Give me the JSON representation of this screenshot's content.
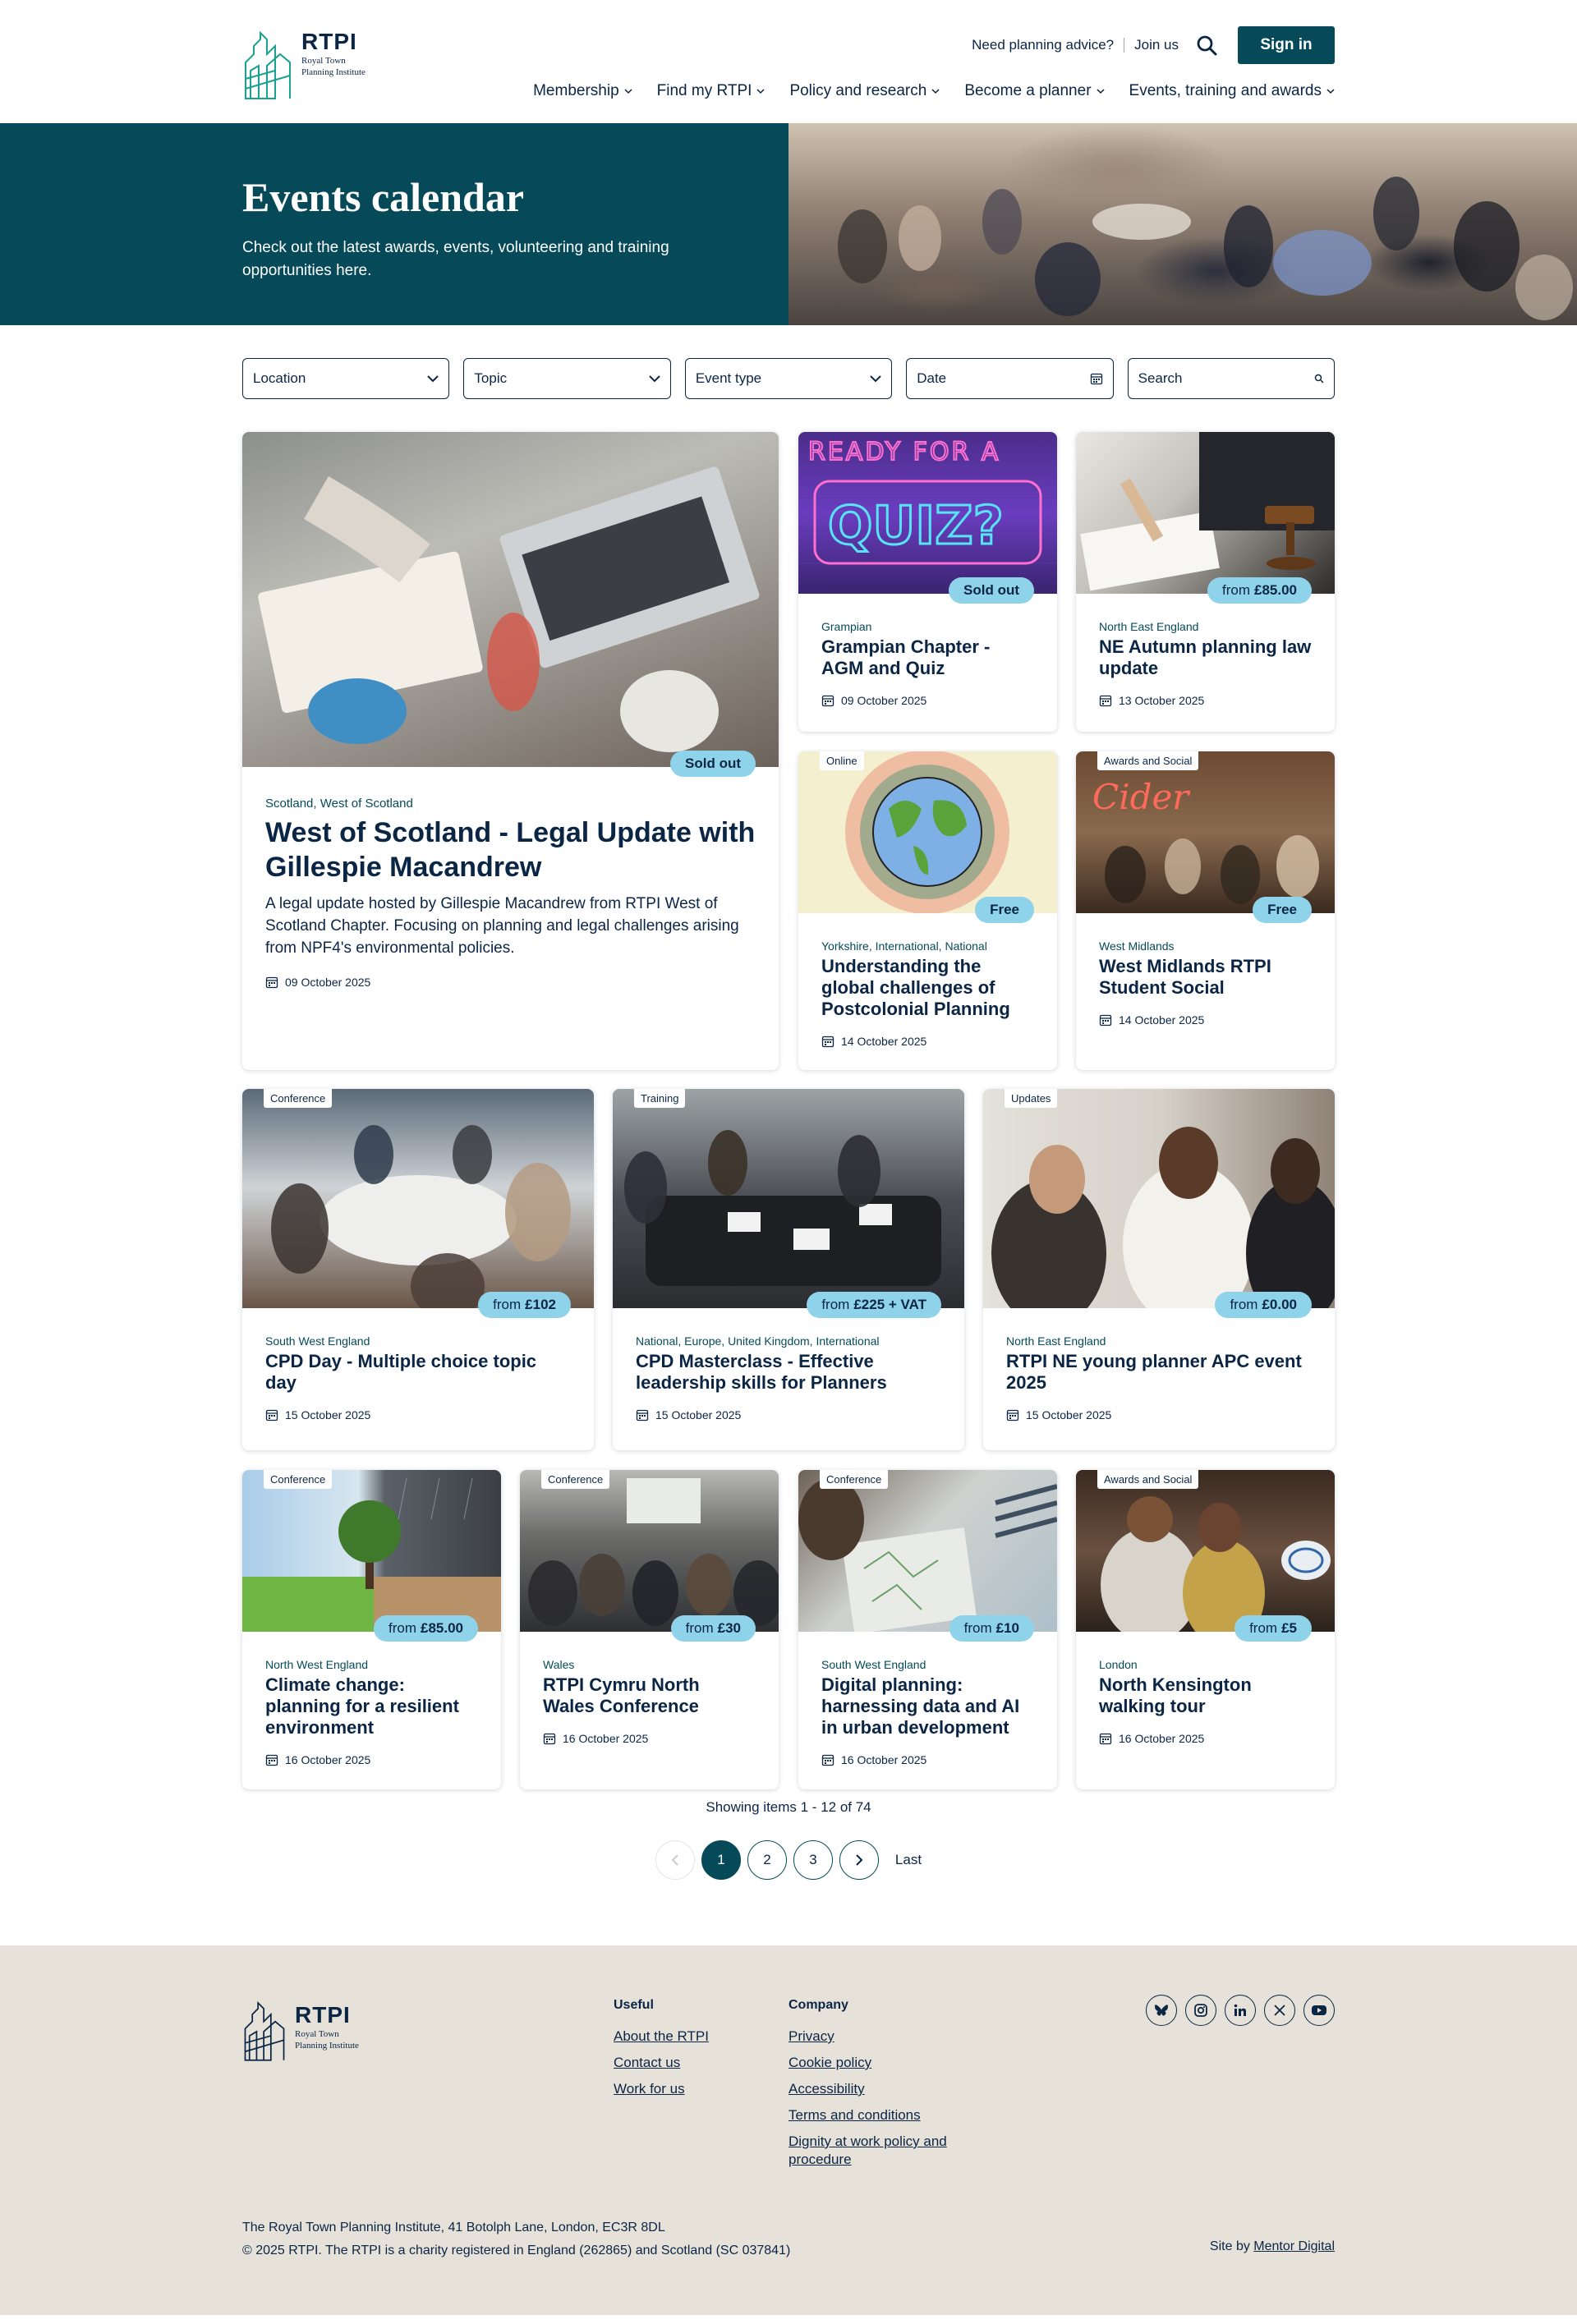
{
  "header": {
    "brand": "RTPI",
    "brand_sub_1": "Royal Town",
    "brand_sub_2": "Planning Institute",
    "advice_link": "Need planning advice?",
    "join_link": "Join us",
    "signin_label": "Sign in",
    "nav": [
      "Membership",
      "Find my RTPI",
      "Policy and research",
      "Become a planner",
      "Events, training and awards"
    ]
  },
  "hero": {
    "title": "Events calendar",
    "subtitle": "Check out the latest awards, events, volunteering and training opportunities here."
  },
  "filters": {
    "location": "Location",
    "topic": "Topic",
    "event_type": "Event type",
    "date": "Date",
    "search": "Search"
  },
  "cards": [
    {
      "region": "Scotland, West of Scotland",
      "title": "West of Scotland - Legal Update with Gillespie Macandrew",
      "description": "A legal update hosted by Gillespie Macandrew from RTPI West of Scotland Chapter. Focusing on planning and legal challenges arising from NPF4's environmental policies.",
      "date": "09 October 2025",
      "badge": "Sold out",
      "price": ""
    },
    {
      "region": "Grampian",
      "title": "Grampian Chapter - AGM and Quiz",
      "date": "09 October 2025",
      "badge": "Sold out",
      "price": "",
      "tag": "",
      "image_text": "READY FOR A QUIZ?"
    },
    {
      "region": "North East England",
      "title": "NE Autumn planning law update",
      "date": "13 October 2025",
      "price_prefix": "from",
      "price": "£85.00",
      "tag": ""
    },
    {
      "region": "Yorkshire, International, National",
      "title": "Understanding the global challenges of Postcolonial Planning",
      "date": "14 October 2025",
      "badge": "Free",
      "tag": "Online"
    },
    {
      "region": "West Midlands",
      "title": "West Midlands RTPI Student Social",
      "date": "14 October 2025",
      "badge": "Free",
      "tag": "Awards and Social",
      "image_text": "Cider"
    },
    {
      "region": "South West England",
      "title": "CPD Day - Multiple choice topic day",
      "date": "15 October 2025",
      "price_prefix": "from",
      "price": "£102",
      "tag": "Conference"
    },
    {
      "region": "National, Europe, United Kingdom, International",
      "title": "CPD Masterclass - Effective leadership skills for Planners",
      "date": "15 October 2025",
      "price_prefix": "from",
      "price": "£225 + VAT",
      "tag": "Training"
    },
    {
      "region": "North East England",
      "title": "RTPI NE young planner APC event 2025",
      "date": "15 October 2025",
      "price_prefix": "from",
      "price": "£0.00",
      "tag": "Updates"
    },
    {
      "region": "North West England",
      "title": "Climate change: planning for a resilient environment",
      "date": "16 October 2025",
      "price_prefix": "from",
      "price": "£85.00",
      "tag": "Conference"
    },
    {
      "region": "Wales",
      "title": "RTPI Cymru North Wales Conference",
      "date": "16 October 2025",
      "price_prefix": "from",
      "price": "£30",
      "tag": "Conference"
    },
    {
      "region": "South West England",
      "title": "Digital planning: harnessing data and AI in urban development",
      "date": "16 October 2025",
      "price_prefix": "from",
      "price": "£10",
      "tag": "Conference"
    },
    {
      "region": "London",
      "title": "North Kensington walking tour",
      "date": "16 October 2025",
      "price_prefix": "from",
      "price": "£5",
      "tag": "Awards and Social"
    }
  ],
  "pagination": {
    "showing": "Showing items 1 - 12 of 74",
    "pages": [
      "1",
      "2",
      "3"
    ],
    "last": "Last"
  },
  "footer": {
    "useful_heading": "Useful",
    "useful_links": [
      "About the RTPI",
      "Contact us",
      "Work for us"
    ],
    "company_heading": "Company",
    "company_links": [
      "Privacy",
      "Cookie policy",
      "Accessibility",
      "Terms and conditions",
      "Dignity at work policy and procedure"
    ],
    "address": "The Royal Town Planning Institute, 41 Botolph Lane, London, EC3R 8DL",
    "copyright": "© 2025 RTPI. The RTPI is a charity registered in England (262865) and Scotland (SC 037841)",
    "site_by_prefix": "Site by",
    "site_by_link": "Mentor Digital",
    "socials": [
      "bluesky-icon",
      "instagram-icon",
      "linkedin-icon",
      "x-icon",
      "youtube-icon"
    ]
  },
  "colors": {
    "primary_teal": "#064a59",
    "navy_text": "#0b2545",
    "price_badge": "#8ed3ea",
    "footer_bg": "#e6e2da"
  }
}
